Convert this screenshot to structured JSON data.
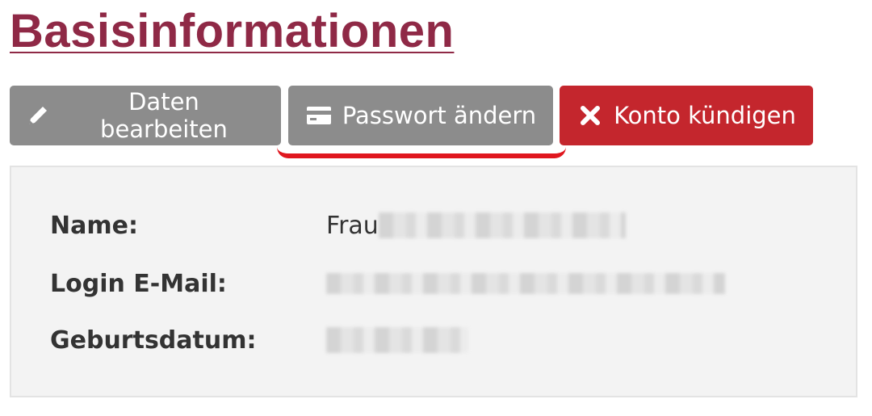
{
  "page": {
    "title": "Basisinformationen"
  },
  "toolbar": {
    "edit_label": "Daten bearbeiten",
    "password_label": "Passwort ändern",
    "cancel_label": "Konto kündigen"
  },
  "info": {
    "name_label": "Name:",
    "name_value_visible": "Frau",
    "email_label": "Login E-Mail:",
    "birthdate_label": "Geburtsdatum:"
  },
  "icons": {
    "edit": "pencil-icon",
    "password": "credit-card-icon",
    "cancel": "close-icon"
  },
  "colors": {
    "title": "#8f2946",
    "button_gray": "#8c8c8c",
    "button_red": "#c4262d",
    "highlight": "#e0171f",
    "panel_bg": "#f3f3f3"
  }
}
